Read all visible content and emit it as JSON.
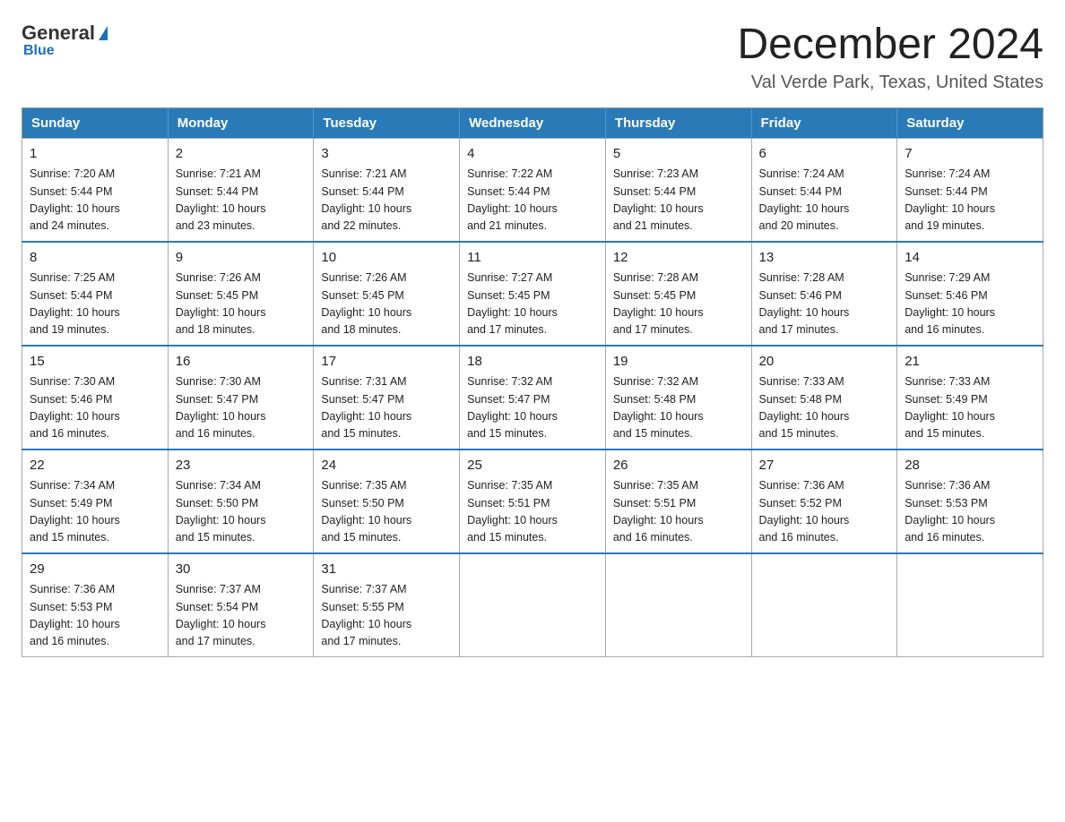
{
  "logo": {
    "general": "General",
    "triangle": "",
    "blue": "Blue"
  },
  "header": {
    "month": "December 2024",
    "location": "Val Verde Park, Texas, United States"
  },
  "weekdays": [
    "Sunday",
    "Monday",
    "Tuesday",
    "Wednesday",
    "Thursday",
    "Friday",
    "Saturday"
  ],
  "weeks": [
    [
      {
        "day": "1",
        "sunrise": "7:20 AM",
        "sunset": "5:44 PM",
        "daylight": "10 hours and 24 minutes."
      },
      {
        "day": "2",
        "sunrise": "7:21 AM",
        "sunset": "5:44 PM",
        "daylight": "10 hours and 23 minutes."
      },
      {
        "day": "3",
        "sunrise": "7:21 AM",
        "sunset": "5:44 PM",
        "daylight": "10 hours and 22 minutes."
      },
      {
        "day": "4",
        "sunrise": "7:22 AM",
        "sunset": "5:44 PM",
        "daylight": "10 hours and 21 minutes."
      },
      {
        "day": "5",
        "sunrise": "7:23 AM",
        "sunset": "5:44 PM",
        "daylight": "10 hours and 21 minutes."
      },
      {
        "day": "6",
        "sunrise": "7:24 AM",
        "sunset": "5:44 PM",
        "daylight": "10 hours and 20 minutes."
      },
      {
        "day": "7",
        "sunrise": "7:24 AM",
        "sunset": "5:44 PM",
        "daylight": "10 hours and 19 minutes."
      }
    ],
    [
      {
        "day": "8",
        "sunrise": "7:25 AM",
        "sunset": "5:44 PM",
        "daylight": "10 hours and 19 minutes."
      },
      {
        "day": "9",
        "sunrise": "7:26 AM",
        "sunset": "5:45 PM",
        "daylight": "10 hours and 18 minutes."
      },
      {
        "day": "10",
        "sunrise": "7:26 AM",
        "sunset": "5:45 PM",
        "daylight": "10 hours and 18 minutes."
      },
      {
        "day": "11",
        "sunrise": "7:27 AM",
        "sunset": "5:45 PM",
        "daylight": "10 hours and 17 minutes."
      },
      {
        "day": "12",
        "sunrise": "7:28 AM",
        "sunset": "5:45 PM",
        "daylight": "10 hours and 17 minutes."
      },
      {
        "day": "13",
        "sunrise": "7:28 AM",
        "sunset": "5:46 PM",
        "daylight": "10 hours and 17 minutes."
      },
      {
        "day": "14",
        "sunrise": "7:29 AM",
        "sunset": "5:46 PM",
        "daylight": "10 hours and 16 minutes."
      }
    ],
    [
      {
        "day": "15",
        "sunrise": "7:30 AM",
        "sunset": "5:46 PM",
        "daylight": "10 hours and 16 minutes."
      },
      {
        "day": "16",
        "sunrise": "7:30 AM",
        "sunset": "5:47 PM",
        "daylight": "10 hours and 16 minutes."
      },
      {
        "day": "17",
        "sunrise": "7:31 AM",
        "sunset": "5:47 PM",
        "daylight": "10 hours and 15 minutes."
      },
      {
        "day": "18",
        "sunrise": "7:32 AM",
        "sunset": "5:47 PM",
        "daylight": "10 hours and 15 minutes."
      },
      {
        "day": "19",
        "sunrise": "7:32 AM",
        "sunset": "5:48 PM",
        "daylight": "10 hours and 15 minutes."
      },
      {
        "day": "20",
        "sunrise": "7:33 AM",
        "sunset": "5:48 PM",
        "daylight": "10 hours and 15 minutes."
      },
      {
        "day": "21",
        "sunrise": "7:33 AM",
        "sunset": "5:49 PM",
        "daylight": "10 hours and 15 minutes."
      }
    ],
    [
      {
        "day": "22",
        "sunrise": "7:34 AM",
        "sunset": "5:49 PM",
        "daylight": "10 hours and 15 minutes."
      },
      {
        "day": "23",
        "sunrise": "7:34 AM",
        "sunset": "5:50 PM",
        "daylight": "10 hours and 15 minutes."
      },
      {
        "day": "24",
        "sunrise": "7:35 AM",
        "sunset": "5:50 PM",
        "daylight": "10 hours and 15 minutes."
      },
      {
        "day": "25",
        "sunrise": "7:35 AM",
        "sunset": "5:51 PM",
        "daylight": "10 hours and 15 minutes."
      },
      {
        "day": "26",
        "sunrise": "7:35 AM",
        "sunset": "5:51 PM",
        "daylight": "10 hours and 16 minutes."
      },
      {
        "day": "27",
        "sunrise": "7:36 AM",
        "sunset": "5:52 PM",
        "daylight": "10 hours and 16 minutes."
      },
      {
        "day": "28",
        "sunrise": "7:36 AM",
        "sunset": "5:53 PM",
        "daylight": "10 hours and 16 minutes."
      }
    ],
    [
      {
        "day": "29",
        "sunrise": "7:36 AM",
        "sunset": "5:53 PM",
        "daylight": "10 hours and 16 minutes."
      },
      {
        "day": "30",
        "sunrise": "7:37 AM",
        "sunset": "5:54 PM",
        "daylight": "10 hours and 17 minutes."
      },
      {
        "day": "31",
        "sunrise": "7:37 AM",
        "sunset": "5:55 PM",
        "daylight": "10 hours and 17 minutes."
      },
      null,
      null,
      null,
      null
    ]
  ],
  "labels": {
    "sunrise": "Sunrise:",
    "sunset": "Sunset:",
    "daylight": "Daylight:"
  }
}
